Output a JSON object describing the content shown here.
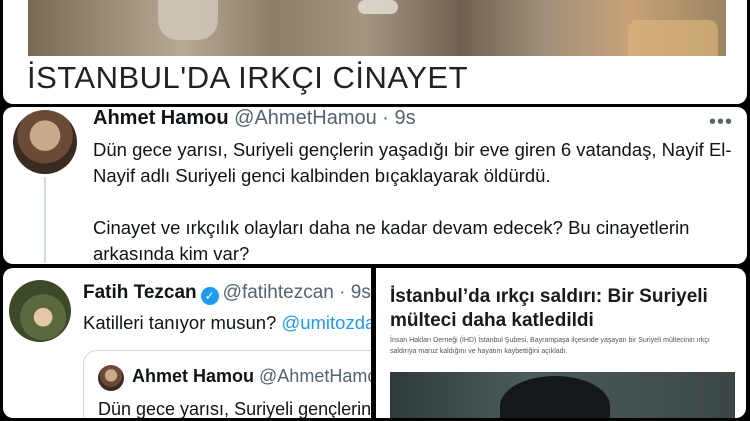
{
  "headline": "İSTANBUL'DA IRKÇI CİNAYET",
  "tweet1": {
    "name": "Ahmet Hamou",
    "handle": "@AhmetHamou",
    "sep": "·",
    "time": "9s",
    "more_icon": "more-dots-icon",
    "paragraph1": "Dün gece yarısı, Suriyeli gençlerin yaşadığı bir eve giren 6 vatandaş, Nayif El-Nayif adlı Suriyeli genci kalbinden bıçaklayarak öldürdü.",
    "paragraph2": "Cinayet ve ırkçılık olayları daha ne kadar devam edecek? Bu cinayetlerin arkasında kim var?"
  },
  "tweet2": {
    "name": "Fatih Tezcan",
    "verified_icon": "verified-badge-icon",
    "handle": "@fatihtezcan",
    "sep": "·",
    "time": "9s",
    "text": "Katilleri tanıyor musun?",
    "mention": "@umitozdag",
    "quote": {
      "name": "Ahmet Hamou",
      "handle": "@AhmetHamou",
      "text": "Dün gece yarısı, Suriyeli gençlerin"
    }
  },
  "article": {
    "title": "İstanbul’da ırkçı saldırı: Bir Suriyeli mülteci daha katledildi",
    "summary": "İnsan Hakları Derneği (İHD) İstanbul Şubesi, Bayrampaşa ilçesinde yaşayan bir Suriyeli mültecinin ırkçı saldırıya maruz kaldığını ve hayatını kaybettiğini açıkladı."
  }
}
